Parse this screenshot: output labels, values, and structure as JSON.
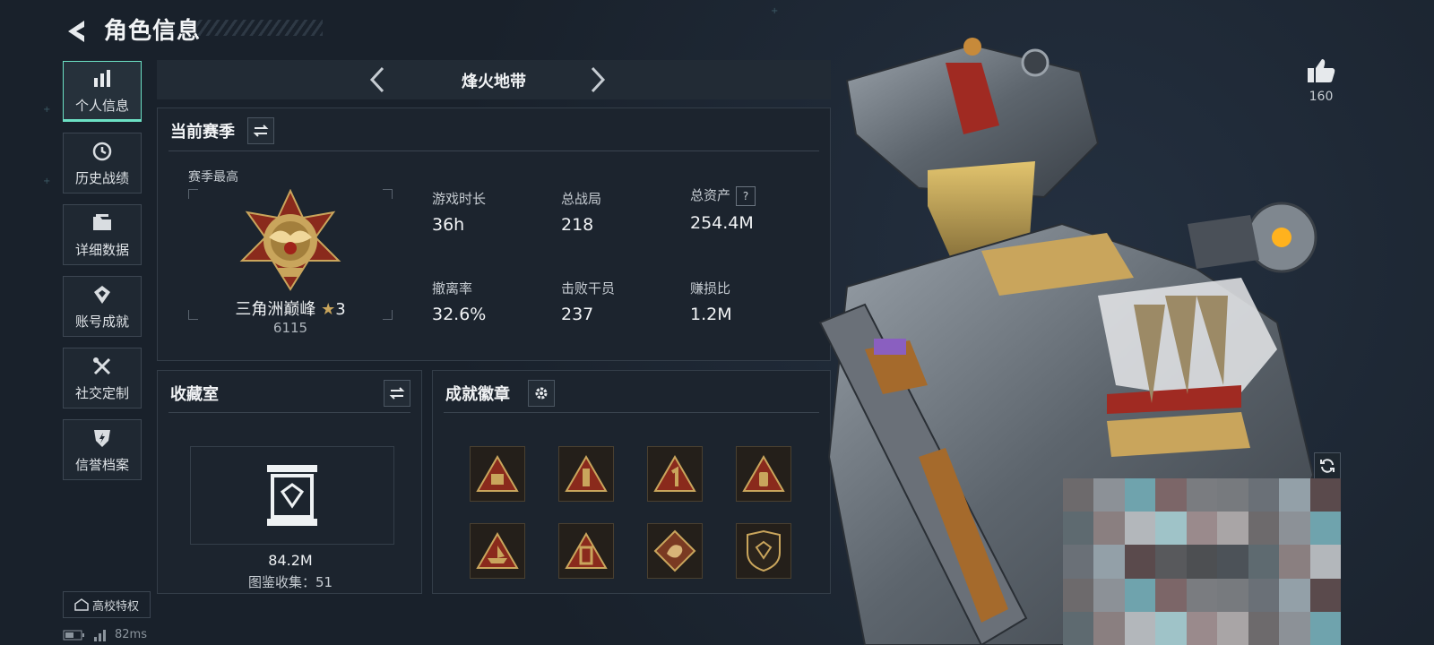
{
  "header": {
    "title": "角色信息"
  },
  "nav": {
    "items": [
      {
        "label": "个人信息",
        "icon": "bar-chart-icon",
        "active": true
      },
      {
        "label": "历史战绩",
        "icon": "history-clock-icon",
        "active": false
      },
      {
        "label": "详细数据",
        "icon": "folder-icon",
        "active": false
      },
      {
        "label": "账号成就",
        "icon": "achievement-icon",
        "active": false
      },
      {
        "label": "社交定制",
        "icon": "tools-icon",
        "active": false
      },
      {
        "label": "信誉档案",
        "icon": "shield-lightning-icon",
        "active": false
      }
    ],
    "campus_label": "高校特权"
  },
  "status": {
    "ping": "82ms"
  },
  "mode": {
    "label": "烽火地带"
  },
  "season": {
    "title": "当前赛季",
    "best_label": "赛季最高",
    "rank_name": "三角洲巅峰",
    "rank_stars": "3",
    "rank_score": "6115",
    "stats": [
      {
        "key": "游戏时长",
        "value": "36h"
      },
      {
        "key": "总战局",
        "value": "218"
      },
      {
        "key": "总资产",
        "value": "254.4M",
        "help": "?"
      },
      {
        "key": "撤离率",
        "value": "32.6%"
      },
      {
        "key": "击败干员",
        "value": "237"
      },
      {
        "key": "赚损比",
        "value": "1.2M"
      }
    ]
  },
  "collection": {
    "title": "收藏室",
    "value": "84.2M",
    "count_label": "图鉴收集：",
    "count": "51"
  },
  "achievements": {
    "title": "成就徽章",
    "badges": [
      "badge-triangle-crate",
      "badge-triangle-tower",
      "badge-triangle-one",
      "badge-triangle-bottle",
      "badge-triangle-ship",
      "badge-triangle-lantern",
      "badge-diamond-dragon",
      "badge-shield-gem"
    ]
  },
  "profile": {
    "likes": "160"
  },
  "colors": {
    "accent": "#6ce0c4",
    "gold": "#c9a55c",
    "badge_red": "#8a2a1c"
  }
}
